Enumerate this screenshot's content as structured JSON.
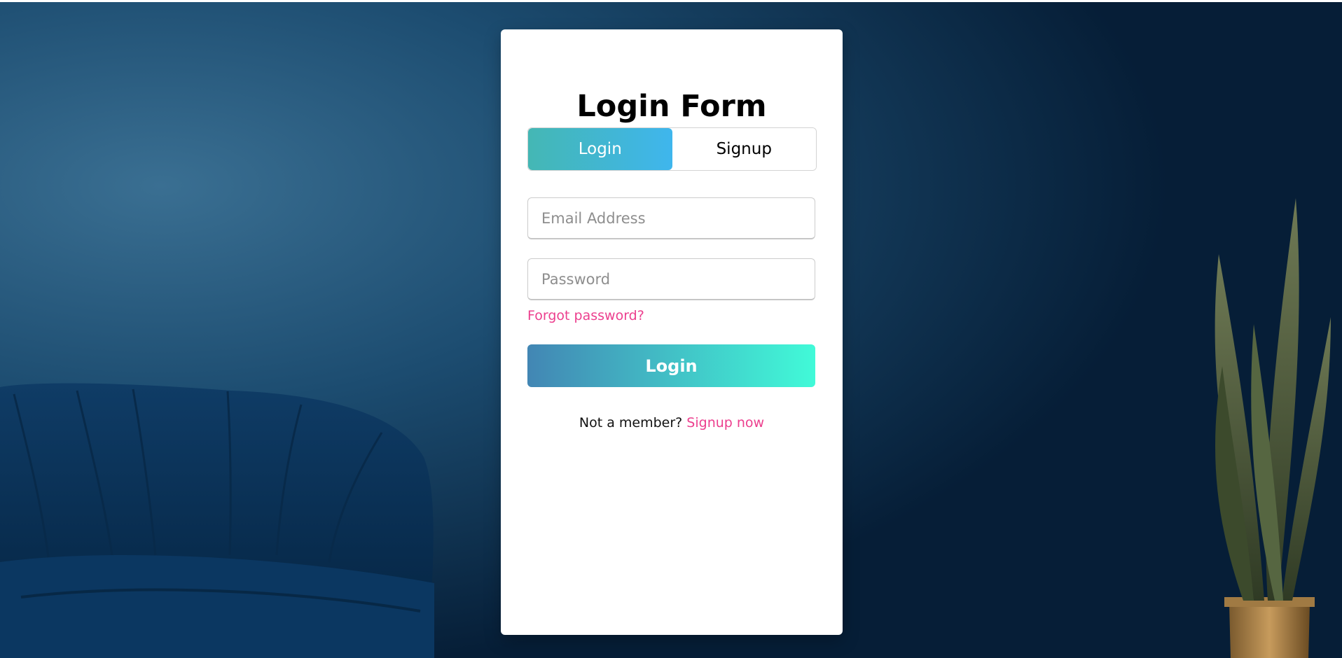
{
  "page": {
    "background_color": "#0a2f4d",
    "card_color": "#ffffff",
    "accent_pink": "#ec3f8e"
  },
  "form": {
    "title": "Login Form",
    "tabs": {
      "login_label": "Login",
      "signup_label": "Signup",
      "active": "login"
    },
    "email": {
      "placeholder": "Email Address",
      "value": ""
    },
    "password": {
      "placeholder": "Password",
      "value": ""
    },
    "forgot_label": "Forgot password?",
    "submit_label": "Login",
    "signup_prompt": "Not a member?",
    "signup_link_label": "Signup now"
  }
}
